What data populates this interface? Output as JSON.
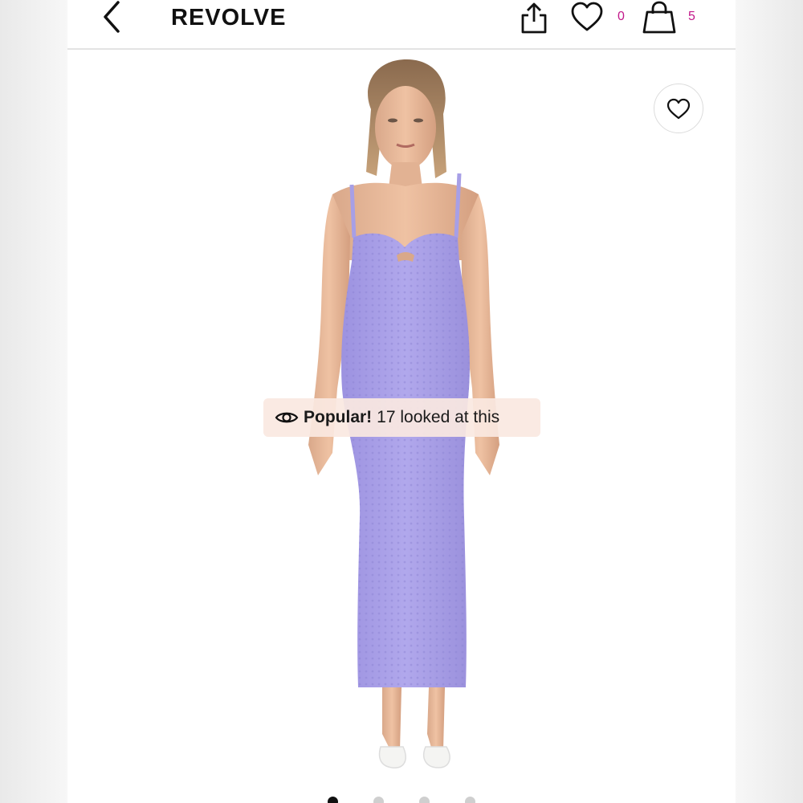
{
  "header": {
    "brand": "REVOLVE",
    "wishlist_count": "0",
    "bag_count": "5",
    "icons": [
      "chevron-left-icon",
      "share-icon",
      "heart-icon",
      "shopping-bag-icon"
    ]
  },
  "product": {
    "favorite_icon": "heart-icon",
    "popular_label": "Popular!",
    "popular_text": "17 looked at this",
    "carousel_dots": 4,
    "active_dot": 0
  },
  "colors": {
    "accent": "#c2188a",
    "dress": "#a79fe6",
    "popular_bg": "#fae8e1"
  }
}
